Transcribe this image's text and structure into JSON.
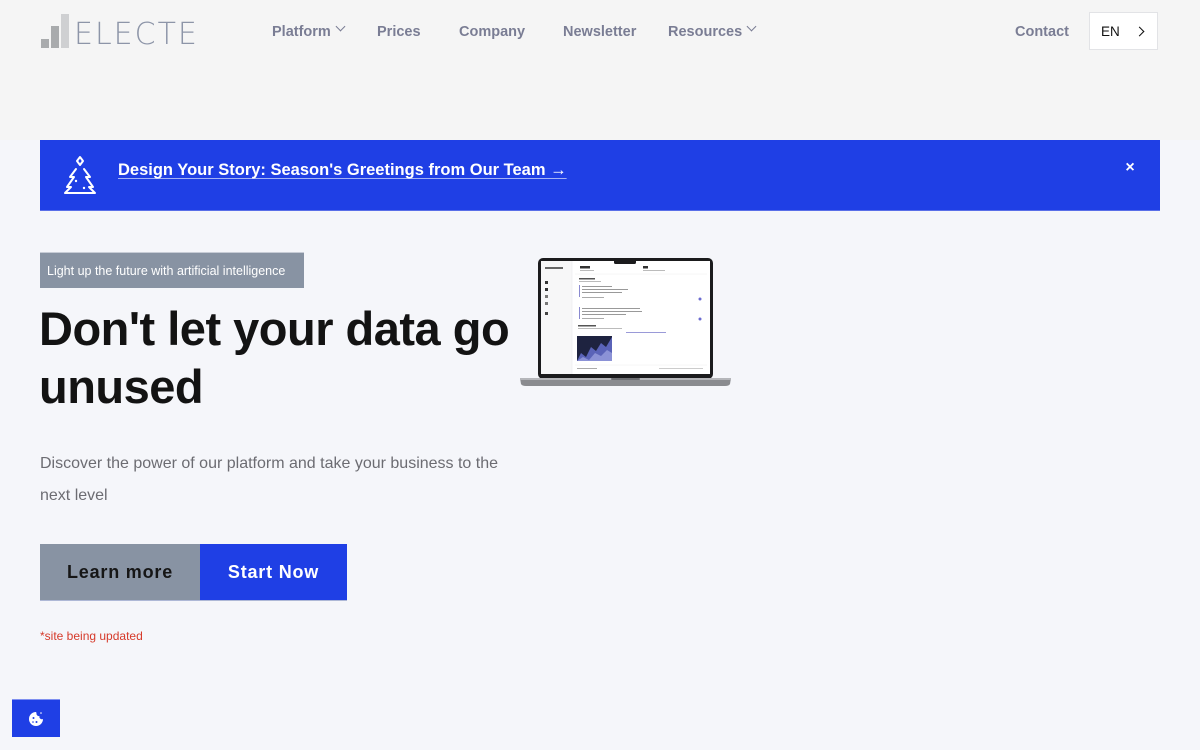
{
  "header": {
    "logo_text": "ELECTE",
    "nav": [
      {
        "label": "Platform",
        "has_dropdown": true
      },
      {
        "label": "Prices",
        "has_dropdown": false
      },
      {
        "label": "Company",
        "has_dropdown": false
      },
      {
        "label": "Newsletter",
        "has_dropdown": false
      },
      {
        "label": "Resources",
        "has_dropdown": true
      }
    ],
    "contact_label": "Contact",
    "language": "EN"
  },
  "banner": {
    "icon": "christmas-tree-icon",
    "text": "Design Your Story: Season's Greetings from Our Team →",
    "close_symbol": "×"
  },
  "hero": {
    "eyebrow": "Light up the future with artificial intelligence",
    "title": "Don't let your data go unused",
    "subtitle": "Discover the power of our platform and take your business to the next level",
    "learn_more_label": "Learn more",
    "start_now_label": "Start Now",
    "notice": "*site being updated",
    "laptop_image": "laptop-dashboard-preview"
  },
  "cookie": {
    "icon": "cookie-icon"
  },
  "colors": {
    "brand_blue": "#1f3fe5",
    "muted_button": "#8893a3",
    "notice_red": "#d63a2a",
    "nav_text": "#7a7d94"
  }
}
